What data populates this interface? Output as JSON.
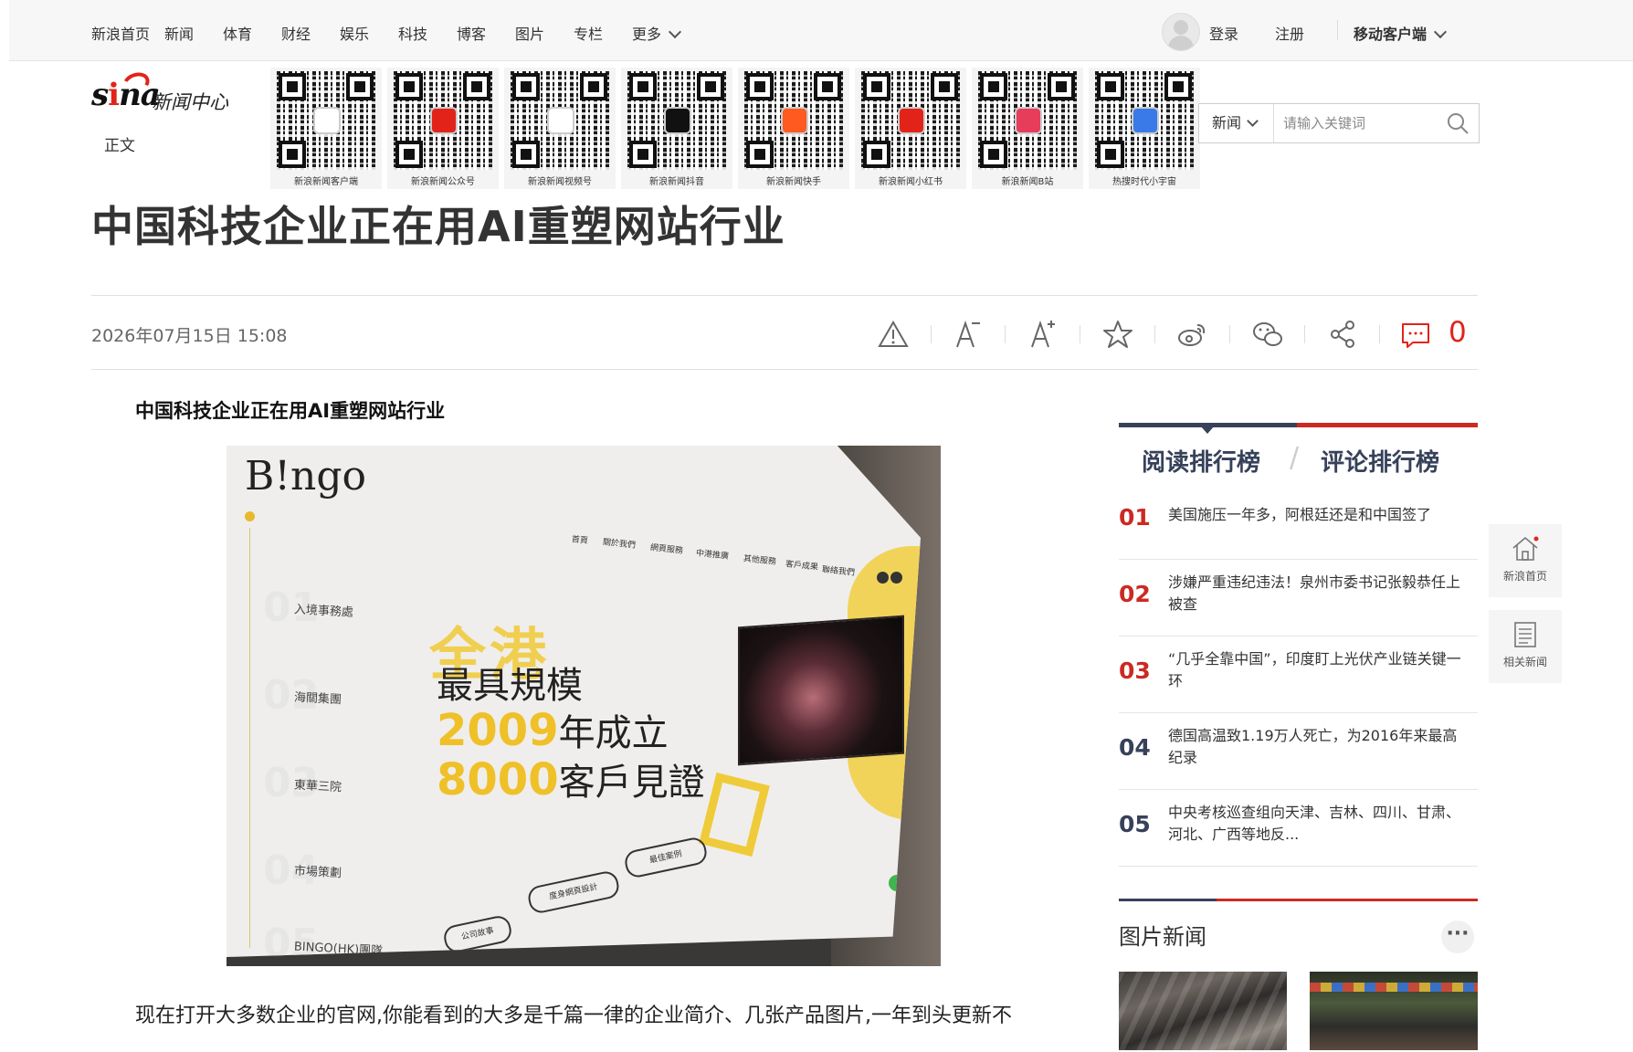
{
  "topnav": {
    "items": [
      "新浪首页",
      "新闻",
      "体育",
      "财经",
      "娱乐",
      "科技",
      "博客",
      "图片",
      "专栏",
      "更多"
    ],
    "login": "登录",
    "register": "注册",
    "mobile_client": "移动客户端"
  },
  "header": {
    "logo_sina": "sina",
    "logo_center": "新闻中心",
    "breadcrumb": "正文",
    "qr_codes": [
      {
        "caption": "新浪新闻客户端"
      },
      {
        "caption": "新浪新闻公众号"
      },
      {
        "caption": "新浪新闻视频号"
      },
      {
        "caption": "新浪新闻抖音"
      },
      {
        "caption": "新浪新闻快手"
      },
      {
        "caption": "新浪新闻小红书"
      },
      {
        "caption": "新浪新闻B站"
      },
      {
        "caption": "热搜时代小宇宙"
      }
    ]
  },
  "search": {
    "category": "新闻",
    "placeholder": "请输入关键词"
  },
  "article": {
    "title": "中国科技企业正在用AI重塑网站行业",
    "date": "2026年07月15日 15:08",
    "comment_count": "0",
    "sub_headline": "中国科技企业正在用AI重塑网站行业",
    "body_first_line": "现在打开大多数企业的官网,你能看到的大多是千篇一律的企业简介、几张产品图片,一年到头更新不"
  },
  "hero_image": {
    "brand": "B!ngo",
    "menu": [
      "首頁",
      "關於我們",
      "網頁服務",
      "中港推廣",
      "其他服務",
      "客戶成果",
      "聯絡我們"
    ],
    "side_items": [
      "入境事務處",
      "海關集團",
      "東華三院",
      "市場策劃",
      "BINGO(HK)團隊"
    ],
    "side_nums": [
      "01",
      "02",
      "03",
      "04",
      "05"
    ],
    "headline_1": "全港",
    "headline_2": "最具規模",
    "headline_3_num": "2009",
    "headline_3_text": "年成立",
    "headline_4_num": "8000",
    "headline_4_text": "客戶見證",
    "pills": [
      "公司故事",
      "度身網頁設計",
      "最佳案例"
    ]
  },
  "ranking": {
    "tab_read": "阅读排行榜",
    "tab_comment": "评论排行榜",
    "items": [
      {
        "num": "01",
        "title": "美国施压一年多，阿根廷还是和中国签了"
      },
      {
        "num": "02",
        "title": "涉嫌严重违纪违法！泉州市委书记张毅恭任上被查"
      },
      {
        "num": "03",
        "title": "“几乎全靠中国”，印度盯上光伏产业链关键一环"
      },
      {
        "num": "04",
        "title": "德国高温致1.19万人死亡，为2016年来最高纪录"
      },
      {
        "num": "05",
        "title": "中央考核巡查组向天津、吉林、四川、甘肃、河北、广西等地反..."
      }
    ],
    "colors": {
      "top3": "#cb2a23",
      "rest": "#37415a"
    }
  },
  "pic_news": {
    "title": "图片新闻",
    "more": "···"
  },
  "float_tools": {
    "home": "新浪首页",
    "related": "相关新闻"
  },
  "colors": {
    "accent_red": "#e2231a",
    "navy": "#37415a"
  }
}
